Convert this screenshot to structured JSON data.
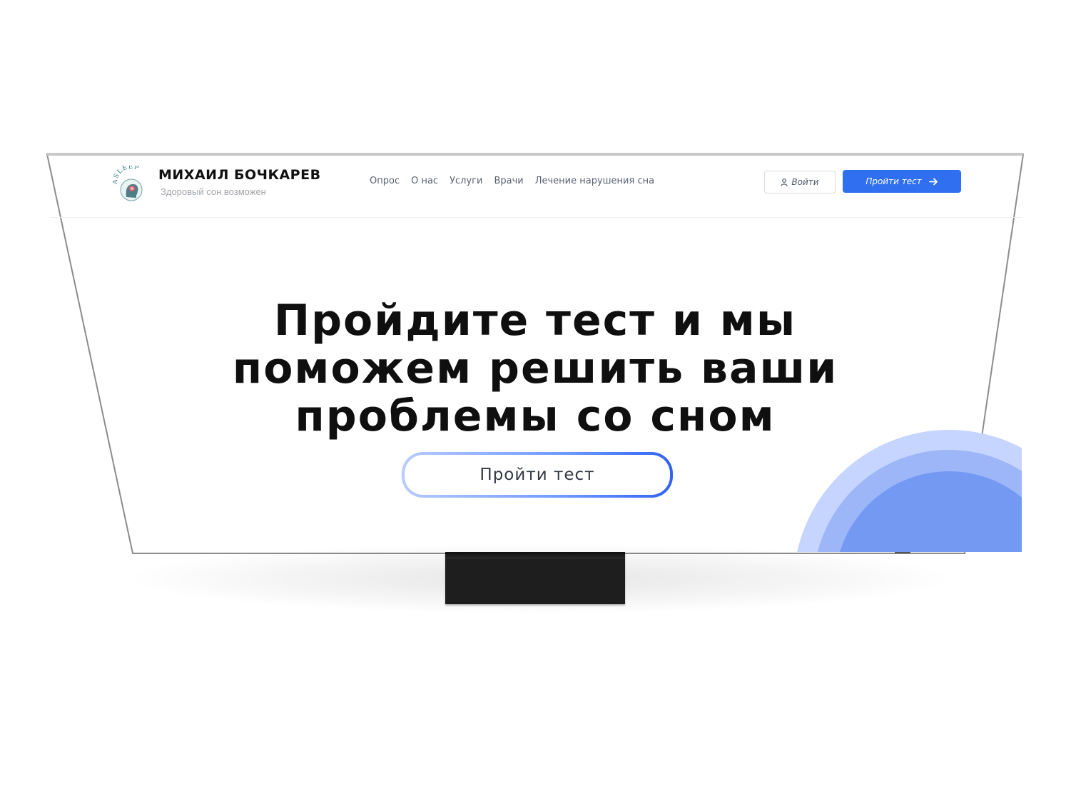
{
  "header": {
    "logo_text": "ASLEEP",
    "brand_name": "МИХАИЛ БОЧКАРЕВ",
    "tagline": "Здоровый сон возможен",
    "nav": [
      {
        "label": "Опрос"
      },
      {
        "label": "О нас"
      },
      {
        "label": "Услуги"
      },
      {
        "label": "Врачи"
      },
      {
        "label": "Лечение нарушения сна"
      }
    ],
    "login_label": "Войти",
    "test_button_label": "Пройти тест"
  },
  "hero": {
    "title_lines": [
      "Пройдите тест и мы",
      "поможем решить ваши",
      "проблемы со сном"
    ],
    "cta_label": "Пройти тест"
  },
  "colors": {
    "accent": "#2f6ff0",
    "deco_light": "#c6d5ff",
    "deco_mid": "#9db6f8",
    "deco_dark": "#7399f2"
  }
}
